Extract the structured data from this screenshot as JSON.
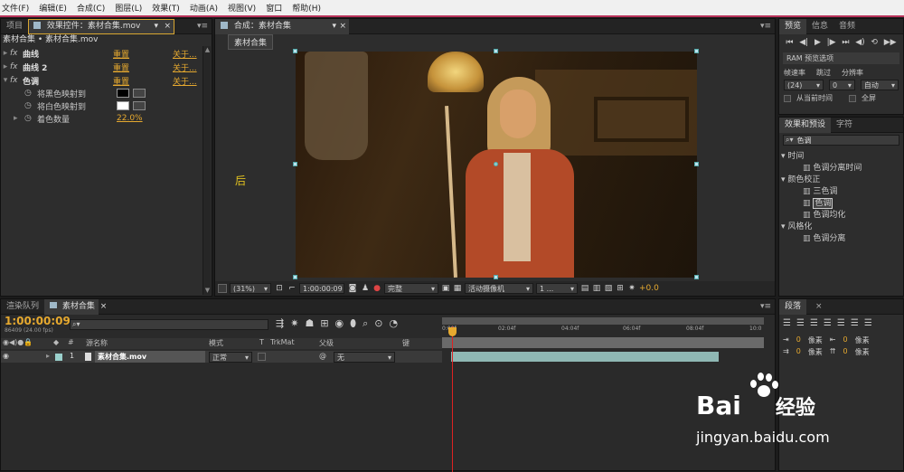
{
  "menubar": [
    "文件(F)",
    "编辑(E)",
    "合成(C)",
    "图层(L)",
    "效果(T)",
    "动画(A)",
    "视图(V)",
    "窗口",
    "帮助(H)"
  ],
  "effect_panel": {
    "tab_project": "项目",
    "tab_effect": "效果控件：素材合集.mov",
    "header": "素材合集 • 素材合集.mov",
    "effects": [
      {
        "fx": "fx",
        "name": "曲线",
        "reset": "重置",
        "about": "关于..."
      },
      {
        "fx": "fx",
        "name": "曲线 2",
        "reset": "重置",
        "about": "关于..."
      },
      {
        "fx": "fx",
        "name": "色调",
        "reset": "重置",
        "about": "关于..."
      }
    ],
    "map_black": "将黑色映射到",
    "map_white": "将白色映射到",
    "amount_label": "着色数量",
    "amount_value": "22.0%"
  },
  "comp_panel": {
    "tab": "合成：素材合集",
    "sub_tab": "素材合集",
    "side_label": "后",
    "zoom": "(31%)",
    "timecode": "1:00:00:09",
    "resolution": "完整",
    "camera": "活动摄像机",
    "views": "1 ...",
    "exposure": "+0.0"
  },
  "preview_panel": {
    "tab_preview": "预览",
    "tab_info": "信息",
    "tab_audio": "音频",
    "ram_label": "RAM 预览选项",
    "fps_label": "帧速率",
    "skip_label": "跳过",
    "res_label": "分辨率",
    "fps_value": "(24)",
    "skip_value": "0",
    "res_value": "自动",
    "from_current": "从当前时间",
    "fullscreen": "全屏"
  },
  "effects_presets": {
    "tab_effects": "效果和预设",
    "tab_chars": "字符",
    "search_value": "色调",
    "tree": [
      {
        "label": "时间",
        "level": 0,
        "expanded": true
      },
      {
        "label": "色调分离时间",
        "level": 1
      },
      {
        "label": "颜色校正",
        "level": 0,
        "expanded": true
      },
      {
        "label": "三色调",
        "level": 1
      },
      {
        "label": "色调",
        "level": 1,
        "selected": true
      },
      {
        "label": "色调均化",
        "level": 1
      },
      {
        "label": "风格化",
        "level": 0,
        "expanded": true
      },
      {
        "label": "色调分离",
        "level": 1
      }
    ]
  },
  "timeline": {
    "tab_render": "渲染队列",
    "tab_comp": "素材合集",
    "timecode": "1:00:00:09",
    "frames": "86409 (24.00 fps)",
    "col_source": "源名称",
    "col_mode": "模式",
    "col_t": "T",
    "col_trkmat": "TrkMat",
    "col_parent": "父级",
    "col_key": "键",
    "layer": {
      "num": "1",
      "name": "素材合集.mov",
      "mode": "正常",
      "parent": "无"
    },
    "ruler": [
      "0:00f",
      "02:04f",
      "04:04f",
      "06:04f",
      "08:04f",
      "10:0"
    ]
  },
  "paragraph": {
    "tab": "段落",
    "indent_label": "像素",
    "values": [
      "0",
      "0",
      "0",
      "0",
      "0"
    ]
  },
  "watermark": {
    "brand": "Bai",
    "brand2": "经验",
    "url": "jingyan.baidu.com"
  }
}
